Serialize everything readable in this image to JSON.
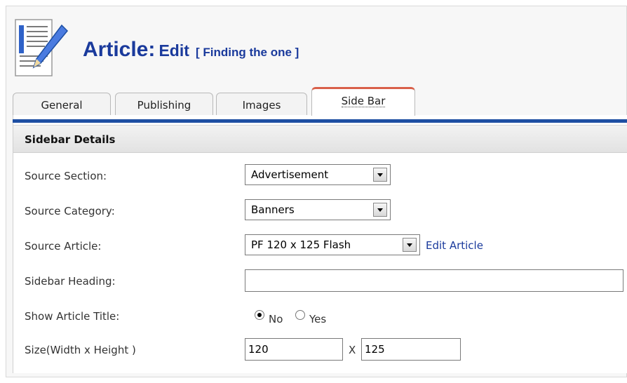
{
  "header": {
    "title_main": "Article:",
    "title_action": "Edit",
    "title_item": "[ Finding the one ]"
  },
  "tabs": [
    {
      "label": "General",
      "active": false
    },
    {
      "label": "Publishing",
      "active": false
    },
    {
      "label": "Images",
      "active": false
    },
    {
      "label": "Side Bar",
      "active": true
    }
  ],
  "panel": {
    "heading": "Sidebar Details",
    "fields": {
      "source_section": {
        "label": "Source Section:",
        "value": "Advertisement"
      },
      "source_category": {
        "label": "Source Category:",
        "value": "Banners"
      },
      "source_article": {
        "label": "Source Article:",
        "value": "PF 120 x 125 Flash",
        "link": "Edit Article"
      },
      "sidebar_heading": {
        "label": "Sidebar Heading:",
        "value": ""
      },
      "show_article_title": {
        "label": "Show Article Title:",
        "options": [
          "No",
          "Yes"
        ],
        "selected": "No"
      },
      "size": {
        "label": "Size(Width x Height )",
        "width": "120",
        "separator": "X",
        "height": "125"
      }
    }
  },
  "colors": {
    "title_blue": "#1a3a9c",
    "tab_accent": "#d9604a",
    "panel_bar": "#1e4fa3"
  },
  "icons": {
    "header_icon": "article-edit-icon"
  }
}
